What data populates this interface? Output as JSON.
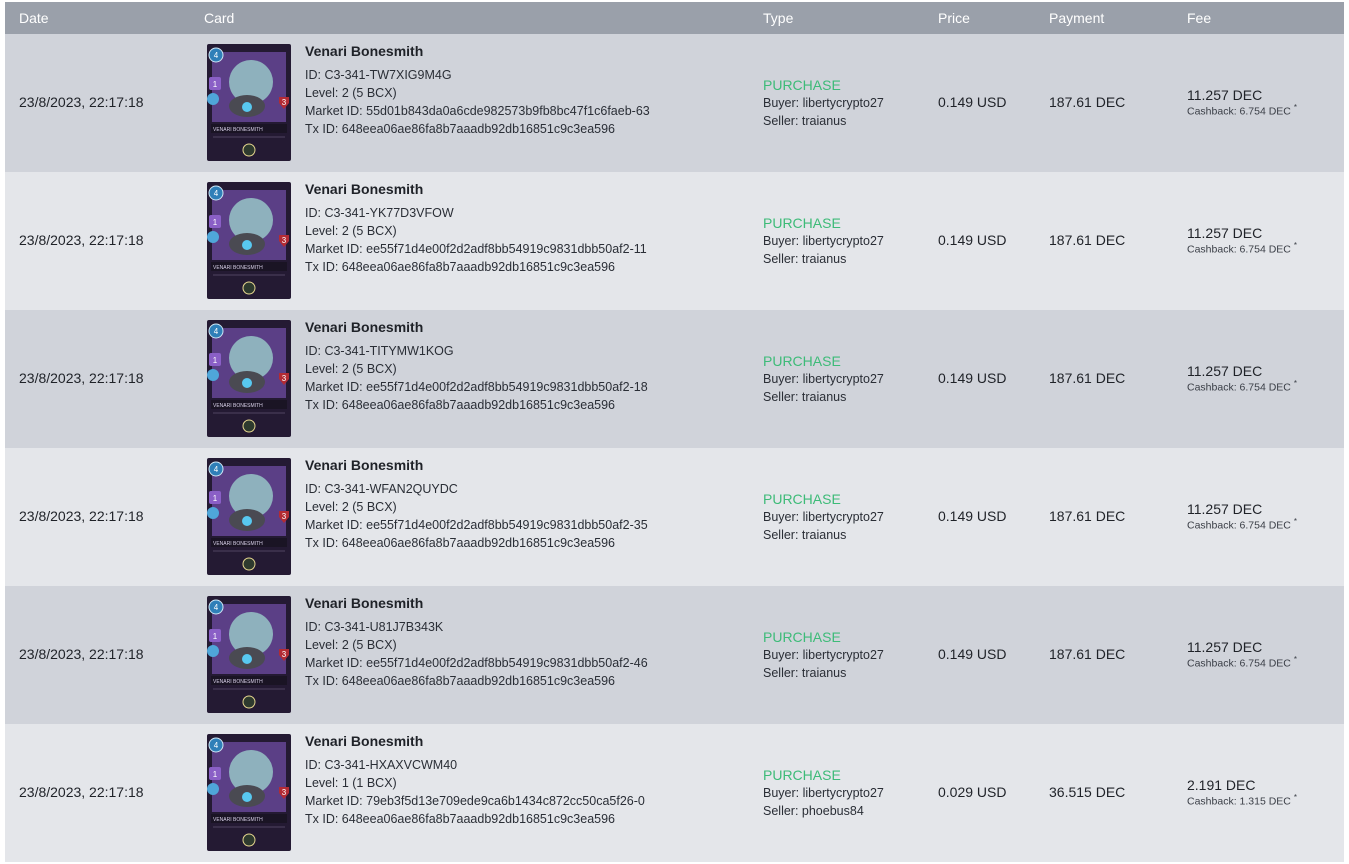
{
  "headers": {
    "date": "Date",
    "card": "Card",
    "type": "Type",
    "price": "Price",
    "payment": "Payment",
    "fee": "Fee"
  },
  "card_art": {
    "frame_color": "#241a33",
    "art_color": "#5b3f86",
    "ghost_color": "#9fd8cf",
    "mana": "4",
    "attack": "1",
    "health": "3",
    "plate_text": "VENARI BONESMITH"
  },
  "rows": [
    {
      "date": "23/8/2023, 22:17:18",
      "name": "Venari Bonesmith",
      "id": "ID: C3-341-TW7XIG9M4G",
      "level": "Level: 2 (5 BCX)",
      "market_id": "Market ID: 55d01b843da0a6cde982573b9fb8bc47f1c6faeb-63",
      "tx_id": "Tx ID: 648eea06ae86fa8b7aaadb92db16851c9c3ea596",
      "type": "PURCHASE",
      "buyer": "Buyer: libertycrypto27",
      "seller": "Seller: traianus",
      "price": "0.149 USD",
      "payment": "187.61 DEC",
      "fee": "11.257 DEC",
      "cashback": "Cashback: 6.754 DEC",
      "asterisk": "*"
    },
    {
      "date": "23/8/2023, 22:17:18",
      "name": "Venari Bonesmith",
      "id": "ID: C3-341-YK77D3VFOW",
      "level": "Level: 2 (5 BCX)",
      "market_id": "Market ID: ee55f71d4e00f2d2adf8bb54919c9831dbb50af2-11",
      "tx_id": "Tx ID: 648eea06ae86fa8b7aaadb92db16851c9c3ea596",
      "type": "PURCHASE",
      "buyer": "Buyer: libertycrypto27",
      "seller": "Seller: traianus",
      "price": "0.149 USD",
      "payment": "187.61 DEC",
      "fee": "11.257 DEC",
      "cashback": "Cashback: 6.754 DEC",
      "asterisk": "*"
    },
    {
      "date": "23/8/2023, 22:17:18",
      "name": "Venari Bonesmith",
      "id": "ID: C3-341-TITYMW1KOG",
      "level": "Level: 2 (5 BCX)",
      "market_id": "Market ID: ee55f71d4e00f2d2adf8bb54919c9831dbb50af2-18",
      "tx_id": "Tx ID: 648eea06ae86fa8b7aaadb92db16851c9c3ea596",
      "type": "PURCHASE",
      "buyer": "Buyer: libertycrypto27",
      "seller": "Seller: traianus",
      "price": "0.149 USD",
      "payment": "187.61 DEC",
      "fee": "11.257 DEC",
      "cashback": "Cashback: 6.754 DEC",
      "asterisk": "*"
    },
    {
      "date": "23/8/2023, 22:17:18",
      "name": "Venari Bonesmith",
      "id": "ID: C3-341-WFAN2QUYDC",
      "level": "Level: 2 (5 BCX)",
      "market_id": "Market ID: ee55f71d4e00f2d2adf8bb54919c9831dbb50af2-35",
      "tx_id": "Tx ID: 648eea06ae86fa8b7aaadb92db16851c9c3ea596",
      "type": "PURCHASE",
      "buyer": "Buyer: libertycrypto27",
      "seller": "Seller: traianus",
      "price": "0.149 USD",
      "payment": "187.61 DEC",
      "fee": "11.257 DEC",
      "cashback": "Cashback: 6.754 DEC",
      "asterisk": "*"
    },
    {
      "date": "23/8/2023, 22:17:18",
      "name": "Venari Bonesmith",
      "id": "ID: C3-341-U81J7B343K",
      "level": "Level: 2 (5 BCX)",
      "market_id": "Market ID: ee55f71d4e00f2d2adf8bb54919c9831dbb50af2-46",
      "tx_id": "Tx ID: 648eea06ae86fa8b7aaadb92db16851c9c3ea596",
      "type": "PURCHASE",
      "buyer": "Buyer: libertycrypto27",
      "seller": "Seller: traianus",
      "price": "0.149 USD",
      "payment": "187.61 DEC",
      "fee": "11.257 DEC",
      "cashback": "Cashback: 6.754 DEC",
      "asterisk": "*"
    },
    {
      "date": "23/8/2023, 22:17:18",
      "name": "Venari Bonesmith",
      "id": "ID: C3-341-HXAXVCWM40",
      "level": "Level: 1 (1 BCX)",
      "market_id": "Market ID: 79eb3f5d13e709ede9ca6b1434c872cc50ca5f26-0",
      "tx_id": "Tx ID: 648eea06ae86fa8b7aaadb92db16851c9c3ea596",
      "type": "PURCHASE",
      "buyer": "Buyer: libertycrypto27",
      "seller": "Seller: phoebus84",
      "price": "0.029 USD",
      "payment": "36.515 DEC",
      "fee": "2.191 DEC",
      "cashback": "Cashback: 1.315 DEC",
      "asterisk": "*"
    }
  ]
}
